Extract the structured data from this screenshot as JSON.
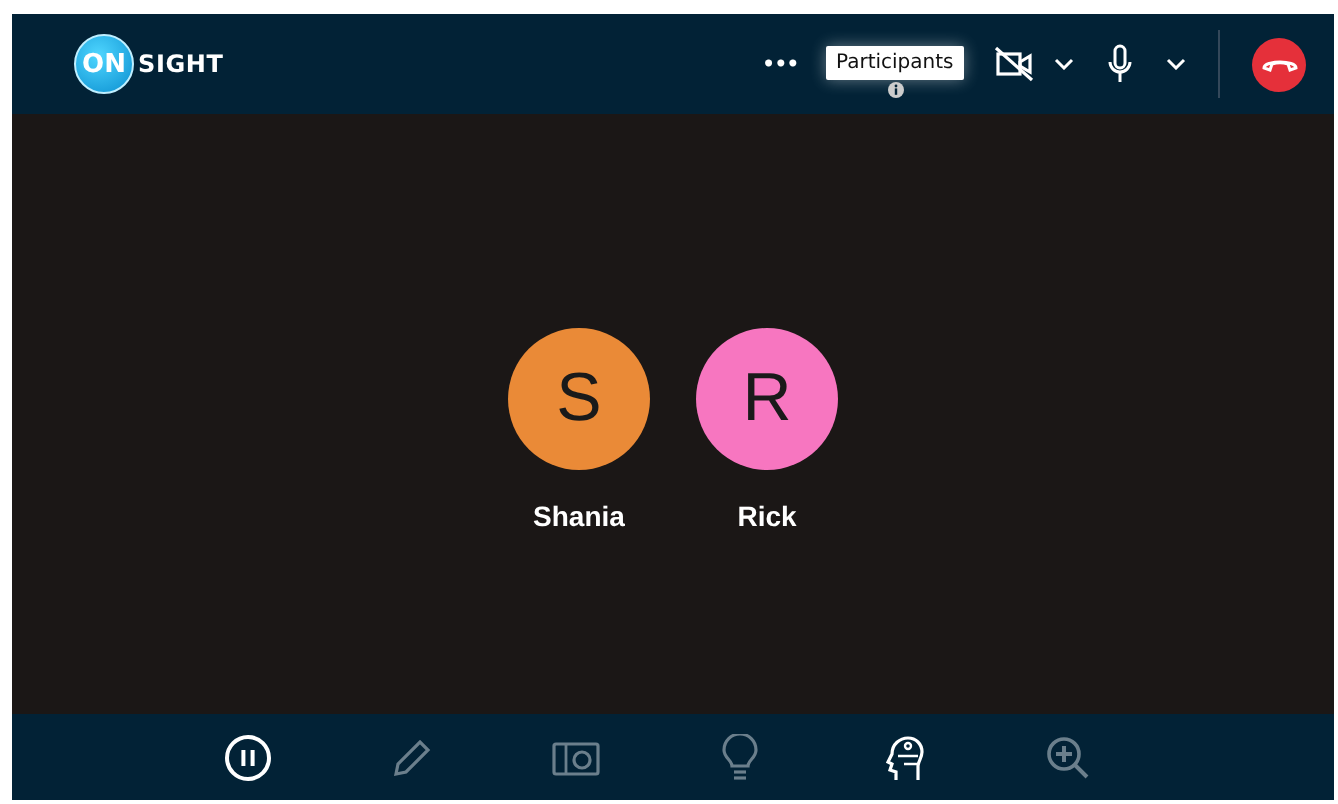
{
  "logo": {
    "badge": "ON",
    "word": "SIGHT"
  },
  "top_bar": {
    "more": "•••",
    "tooltip": "Participants",
    "camera_muted": true
  },
  "participants": [
    {
      "initial": "S",
      "name": "Shania",
      "color": "#ea8a37"
    },
    {
      "initial": "R",
      "name": "Rick",
      "color": "#f776c0"
    }
  ],
  "tools": [
    {
      "kind": "pause",
      "disabled": false
    },
    {
      "kind": "pencil",
      "disabled": true
    },
    {
      "kind": "camera",
      "disabled": true
    },
    {
      "kind": "bulb",
      "disabled": true
    },
    {
      "kind": "head",
      "disabled": false
    },
    {
      "kind": "zoom",
      "disabled": true
    }
  ]
}
